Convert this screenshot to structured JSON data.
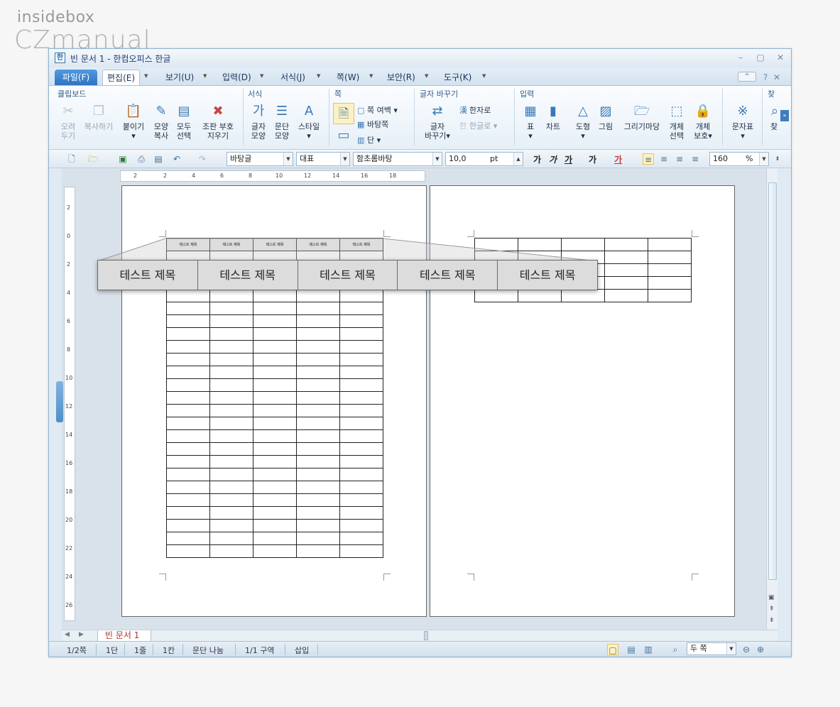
{
  "watermark": {
    "line1": "insidebox",
    "line2": "CZmanual"
  },
  "window": {
    "title": "빈 문서 1 - 한컴오피스 한글"
  },
  "menu": {
    "file": "파일(F)",
    "items": [
      "편집(E)",
      "보기(U)",
      "입력(D)",
      "서식(J)",
      "쪽(W)",
      "보안(R)",
      "도구(K)"
    ]
  },
  "ribbon": {
    "groups": {
      "clipboard": "클립보드",
      "format": "서식",
      "page": "쪽",
      "replace": "글자 바꾸기",
      "input": "입력",
      "find": "찾"
    },
    "buttons": {
      "cut_1": "오려",
      "cut_2": "두기",
      "copy": "복사하기",
      "paste": "붙이기",
      "shape_copy_1": "모양",
      "shape_copy_2": "복사",
      "select_all_1": "모두",
      "select_all_2": "선택",
      "clear_1": "조판 부호",
      "clear_2": "지우기",
      "char_shape_1": "글자",
      "char_shape_2": "모양",
      "para_shape_1": "문단",
      "para_shape_2": "모양",
      "style": "스타일",
      "page_margin": "쪽 여백",
      "background": "바탕쪽",
      "column": "단",
      "hanja": "한자로",
      "hangul": "한글로",
      "char_replace_1": "글자",
      "char_replace_2": "바꾸기",
      "table": "표",
      "chart": "차트",
      "shape": "도형",
      "image": "그림",
      "drawing": "그리기마당",
      "obj_select_1": "개체",
      "obj_select_2": "선택",
      "obj_protect_1": "개체",
      "obj_protect_2": "보호",
      "symbol": "문자표",
      "find": "찾"
    }
  },
  "toolbar": {
    "style": "바탕글",
    "lang": "대표",
    "font": "함초롬바탕",
    "size": "10,0",
    "size_unit": "pt",
    "bold": "가",
    "italic": "가",
    "underline": "가",
    "strike": "가",
    "color": "가",
    "zoom": "160",
    "zoom_unit": "%"
  },
  "ruler": {
    "h_labels": [
      "2",
      "2",
      "4",
      "6",
      "8",
      "10",
      "12",
      "14",
      "16",
      "18"
    ],
    "v_labels": [
      "2",
      "0",
      "2",
      "4",
      "6",
      "8",
      "10",
      "12",
      "14",
      "16",
      "18",
      "20",
      "22",
      "24",
      "26"
    ]
  },
  "table_header_small": [
    "테스트 제목",
    "테스트 제목",
    "테스트 제목",
    "테스트 제목",
    "테스트 제목"
  ],
  "zoom_callout": [
    "테스트 제목",
    "테스트 제목",
    "테스트 제목",
    "테스트 제목",
    "테스트 제목"
  ],
  "doc_tab": "빈 문서 1",
  "status": {
    "page": "1/2쪽",
    "column": "1단",
    "line": "1줄",
    "char": "1칸",
    "para_break": "문단 나눔",
    "section": "1/1 구역",
    "insert": "삽입",
    "view_mode": "두 쪽"
  }
}
